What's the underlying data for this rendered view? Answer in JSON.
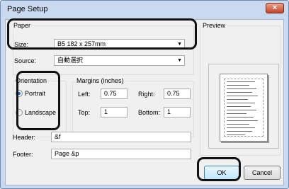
{
  "window": {
    "title": "Page Setup",
    "close_symbol": "×"
  },
  "paper": {
    "group_label": "Paper",
    "size_label": "Size:",
    "size_value": "B5 182 x 257mm",
    "source_label": "Source:",
    "source_value": "自動選択"
  },
  "orientation": {
    "group_label": "Orientation",
    "portrait_label": "Portrait",
    "landscape_label": "Landscape",
    "selected": "Portrait"
  },
  "margins": {
    "group_label": "Margins (inches)",
    "left_label": "Left:",
    "left_value": "0.75",
    "right_label": "Right:",
    "right_value": "0.75",
    "top_label": "Top:",
    "top_value": "1",
    "bottom_label": "Bottom:",
    "bottom_value": "1"
  },
  "preview": {
    "label": "Preview"
  },
  "header": {
    "label": "Header:",
    "value": "&f"
  },
  "footer": {
    "label": "Footer:",
    "value": "Page &p"
  },
  "buttons": {
    "ok": "OK",
    "cancel": "Cancel"
  },
  "colors": {
    "frame": "#c9daf0",
    "close": "#c3432a",
    "annotation": "#111111"
  }
}
